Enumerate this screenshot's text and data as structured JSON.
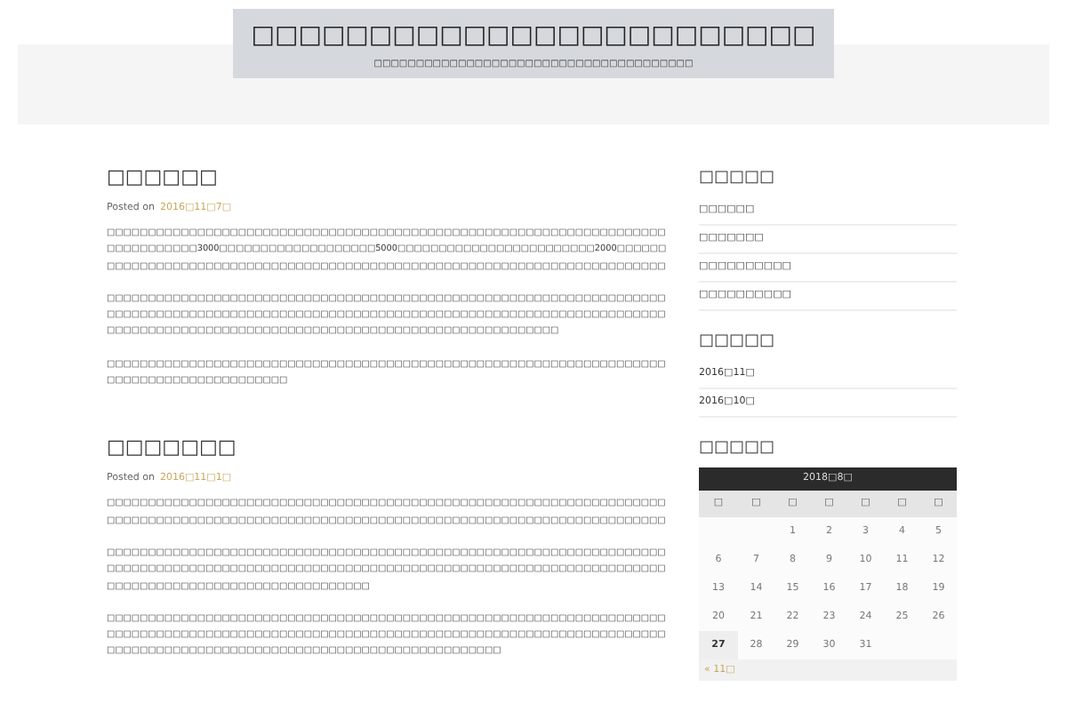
{
  "site": {
    "title": "□□□□□□□□□□□□□□□□□□□□□□□□",
    "tagline": "□□□□□□□□□□□□□□□□□□□□□□□□□□□□□□□□□□□□□□"
  },
  "posts": [
    {
      "title": "□□□□□□",
      "posted_label": "Posted on",
      "date": "2016□11□7□",
      "paragraphs": [
        "□□□□□□□□□□□□□□□□□□□□□□□□□□□□□□□□□□□□□□□□□□□□□□□□□□□□□□□□□□□□□□□□□□□□□□□□□□□□□□□3000□□□□□□□□□□□□□□□□□□□5000□□□□□□□□□□□□□□□□□□□□□□□□2000□□□□□□□□□□□□□□□□□□□□□□□□□□□□□□□□□□□□□□□□□□□□□□□□□□□□□□□□□□□□□□□□□□□□□□□□□□",
        "□□□□□□□□□□□□□□□□□□□□□□□□□□□□□□□□□□□□□□□□□□□□□□□□□□□□□□□□□□□□□□□□□□□□□□□□□□□□□□□□□□□□□□□□□□□□□□□□□□□□□□□□□□□□□□□□□□□□□□□□□□□□□□□□□□□□□□□□□□□□□□□□□□□□□□□□□□□□□□□□□□□□□□□□□□□□□□□□□□□□□□□□□□□□□□□",
        "□□□□□□□□□□□□□□□□□□□□□□□□□□□□□□□□□□□□□□□□□□□□□□□□□□□□□□□□□□□□□□□□□□□□□□□□□□□□□□□□□□□□□□□□□□"
      ]
    },
    {
      "title": "□□□□□□□",
      "posted_label": "Posted on",
      "date": "2016□11□1□",
      "paragraphs": [
        "□□□□□□□□□□□□□□□□□□□□□□□□□□□□□□□□□□□□□□□□□□□□□□□□□□□□□□□□□□□□□□□□□□□□□□□□□□□□□□□□□□□□□□□□□□□□□□□□□□□□□□□□□□□□□□□□□□□□□□□□□□□□□□□□□□□□□□□□",
        "□□□□□□□□□□□□□□□□□□□□□□□□□□□□□□□□□□□□□□□□□□□□□□□□□□□□□□□□□□□□□□□□□□□□□□□□□□□□□□□□□□□□□□□□□□□□□□□□□□□□□□□□□□□□□□□□□□□□□□□□□□□□□□□□□□□□□□□□□□□□□□□□□□□□□□□□□□□□□□□□□□□□□□□□",
        "□□□□□□□□□□□□□□□□□□□□□□□□□□□□□□□□□□□□□□□□□□□□□□□□□□□□□□□□□□□□□□□□□□□□□□□□□□□□□□□□□□□□□□□□□□□□□□□□□□□□□□□□□□□□□□□□□□□□□□□□□□□□□□□□□□□□□□□□□□□□□□□□□□□□□□□□□□□□□□□□□□□□□□□□□□□□□□□□□□□□□□□□"
      ]
    }
  ],
  "sidebar": {
    "recent": {
      "title": "□□□□□",
      "items": [
        "□□□□□□",
        "□□□□□□□",
        "□□□□□□□□□□",
        "□□□□□□□□□□"
      ]
    },
    "archives": {
      "title": "□□□□□",
      "items": [
        "2016□11□",
        "2016□10□"
      ]
    },
    "calendar": {
      "title": "□□□□□",
      "caption": "2018□8□",
      "weekdays": [
        "□",
        "□",
        "□",
        "□",
        "□",
        "□",
        "□"
      ],
      "weeks": [
        [
          {
            "kind": "blank"
          },
          {
            "kind": "blank"
          },
          {
            "day": "1",
            "today": false
          },
          {
            "day": "2",
            "today": false
          },
          {
            "day": "3",
            "today": false
          },
          {
            "day": "4",
            "today": false
          },
          {
            "day": "5",
            "today": false
          }
        ],
        [
          {
            "day": "6",
            "today": false
          },
          {
            "day": "7",
            "today": false
          },
          {
            "day": "8",
            "today": false
          },
          {
            "day": "9",
            "today": false
          },
          {
            "day": "10",
            "today": false
          },
          {
            "day": "11",
            "today": false
          },
          {
            "day": "12",
            "today": false
          }
        ],
        [
          {
            "day": "13",
            "today": false
          },
          {
            "day": "14",
            "today": false
          },
          {
            "day": "15",
            "today": false
          },
          {
            "day": "16",
            "today": false
          },
          {
            "day": "17",
            "today": false
          },
          {
            "day": "18",
            "today": false
          },
          {
            "day": "19",
            "today": false
          }
        ],
        [
          {
            "day": "20",
            "today": false
          },
          {
            "day": "21",
            "today": false
          },
          {
            "day": "22",
            "today": false
          },
          {
            "day": "23",
            "today": false
          },
          {
            "day": "24",
            "today": false
          },
          {
            "day": "25",
            "today": false
          },
          {
            "day": "26",
            "today": false
          }
        ],
        [
          {
            "day": "27",
            "today": true
          },
          {
            "day": "28",
            "today": false
          },
          {
            "day": "29",
            "today": false
          },
          {
            "day": "30",
            "today": false
          },
          {
            "day": "31",
            "today": false
          },
          {
            "kind": "blank"
          },
          {
            "kind": "blank"
          }
        ]
      ],
      "prev": "« 11□"
    }
  }
}
